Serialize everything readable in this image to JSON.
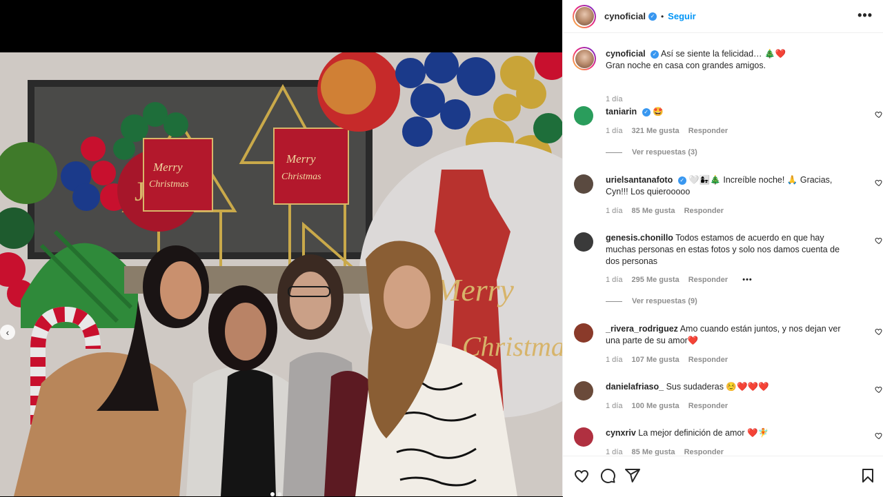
{
  "post": {
    "username": "cynoficial",
    "follow_label": "Seguir",
    "bullet": "•",
    "more_label": "•••",
    "caption_line1": "Así se siente la felicidad… 🎄❤️",
    "caption_line2": "Gran noche en casa con grandes amigos.",
    "caption_time": "1 día",
    "photo_count": 2,
    "active_photo": 1
  },
  "photo": {
    "sign_text_1": "Merry",
    "sign_text_2": "Christmas",
    "letter_j": "J",
    "big_sign_text": "Merry",
    "big_sign_text_2": "Christma"
  },
  "comments": [
    {
      "user": "taniarin",
      "verified": true,
      "text": "🤩",
      "time": "1 día",
      "likes": "321 Me gusta",
      "reply": "Responder",
      "replies": "Ver respuestas (3)",
      "avatar_color": "#2a9d5c"
    },
    {
      "user": "urielsantanafoto",
      "verified": true,
      "text": "🤍👩‍👧🎄 Increíble noche! 🙏 Gracias, Cyn!!! Los quierooooo",
      "time": "1 día",
      "likes": "85 Me gusta",
      "reply": "Responder",
      "avatar_color": "#5a4a40"
    },
    {
      "user": "genesis.chonillo",
      "verified": false,
      "text": "Todos estamos de acuerdo en que hay muchas personas en estas fotos y solo nos damos cuenta de dos personas",
      "time": "1 día",
      "likes": "295 Me gusta",
      "reply": "Responder",
      "replies": "Ver respuestas (9)",
      "extra": "•••",
      "avatar_color": "#3a3a3a"
    },
    {
      "user": "_rivera_rodriguez",
      "verified": false,
      "text": "Amo cuando están juntos, y nos dejan ver una parte de su amor❤️",
      "time": "1 día",
      "likes": "107 Me gusta",
      "reply": "Responder",
      "avatar_color": "#8a3a2a"
    },
    {
      "user": "danielafriaso_",
      "verified": false,
      "text": "Sus sudaderas ☺️❤️❤️❤️",
      "time": "1 día",
      "likes": "100 Me gusta",
      "reply": "Responder",
      "avatar_color": "#6a4a3a"
    },
    {
      "user": "cynxriv",
      "verified": false,
      "text": "La mejor definición de amor ❤️🧚",
      "time": "1 día",
      "likes": "85 Me gusta",
      "reply": "Responder",
      "avatar_color": "#b03040"
    }
  ],
  "icons": {
    "heart": "heart-icon",
    "comment": "comment-icon",
    "share": "share-icon",
    "save": "bookmark-icon",
    "verified": "verified-badge-icon",
    "prev": "chevron-left-icon"
  }
}
